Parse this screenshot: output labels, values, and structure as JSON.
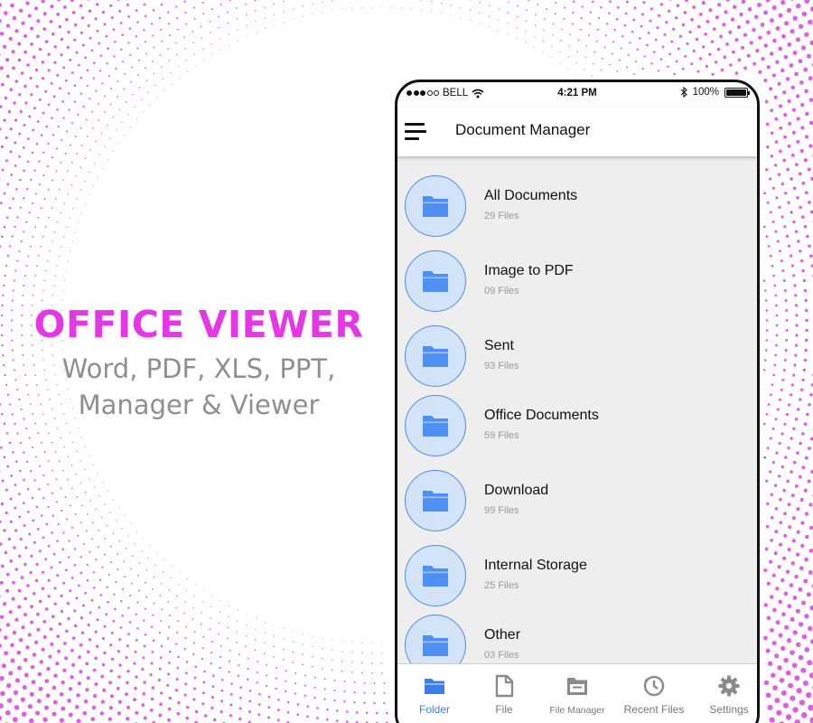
{
  "promo": {
    "title": "OFFICE VIEWER",
    "subtitle_line1": "Word, PDF, XLS, PPT,",
    "subtitle_line2": "Manager & Viewer"
  },
  "status_bar": {
    "carrier": "BELL",
    "time": "4:21 PM",
    "battery": "100%",
    "signal_bars_filled": 3,
    "signal_bars_total": 5
  },
  "app_bar": {
    "title": "Document Manager"
  },
  "folders": [
    {
      "name": "All Documents",
      "count": "29 Files"
    },
    {
      "name": "Image to PDF",
      "count": "09 Files"
    },
    {
      "name": "Sent",
      "count": "93 Files"
    },
    {
      "name": "Office Documents",
      "count": "59 Files"
    },
    {
      "name": "Download",
      "count": "99 Files"
    },
    {
      "name": "Internal Storage",
      "count": "25 Files"
    },
    {
      "name": "Other",
      "count": "03 Files"
    }
  ],
  "bottom_nav": {
    "active": "Folder",
    "items": [
      {
        "label": "Folder",
        "icon": "folder-icon"
      },
      {
        "label": "File",
        "icon": "file-icon"
      },
      {
        "label": "File Manager",
        "icon": "file-manager-icon"
      },
      {
        "label": "Recent Files",
        "icon": "clock-icon"
      },
      {
        "label": "Settings",
        "icon": "gear-icon"
      }
    ]
  },
  "colors": {
    "accent": "#3d7fe8",
    "promo_title": "#e637e6",
    "dots": "#e45ce4",
    "folder_fill": "#4f8ff3",
    "folder_circle": "#d3e3f8",
    "list_background": "#eeeeee"
  }
}
